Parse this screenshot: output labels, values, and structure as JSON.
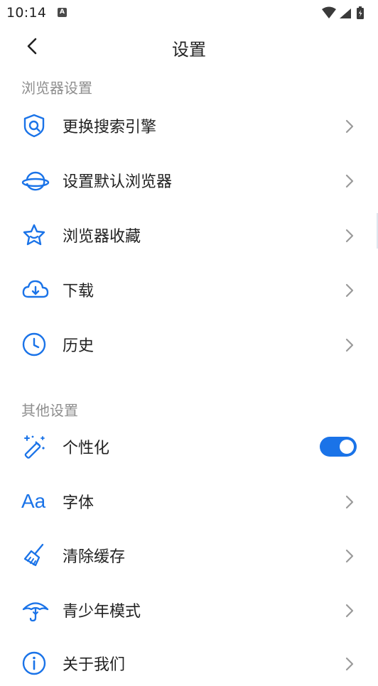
{
  "status": {
    "time": "10:14",
    "notif_letter": "A"
  },
  "header": {
    "title": "设置"
  },
  "sections": {
    "browser": {
      "title": "浏览器设置",
      "items": [
        {
          "label": "更换搜索引擎",
          "icon": "search-engine-icon"
        },
        {
          "label": "设置默认浏览器",
          "icon": "planet-icon"
        },
        {
          "label": "浏览器收藏",
          "icon": "star-icon"
        },
        {
          "label": "下载",
          "icon": "cloud-download-icon"
        },
        {
          "label": "历史",
          "icon": "clock-icon"
        }
      ]
    },
    "other": {
      "title": "其他设置",
      "items": [
        {
          "label": "个性化",
          "icon": "magic-wand-icon",
          "toggle_on": true
        },
        {
          "label": "字体",
          "icon": "font-icon",
          "icon_text": "Aa"
        },
        {
          "label": "清除缓存",
          "icon": "broom-icon"
        },
        {
          "label": "青少年模式",
          "icon": "umbrella-icon"
        },
        {
          "label": "关于我们",
          "icon": "info-icon"
        }
      ]
    }
  },
  "colors": {
    "accent": "#1a73e8",
    "text": "#222222",
    "muted": "#8e8e8e",
    "chevron": "#9a9a9a"
  }
}
